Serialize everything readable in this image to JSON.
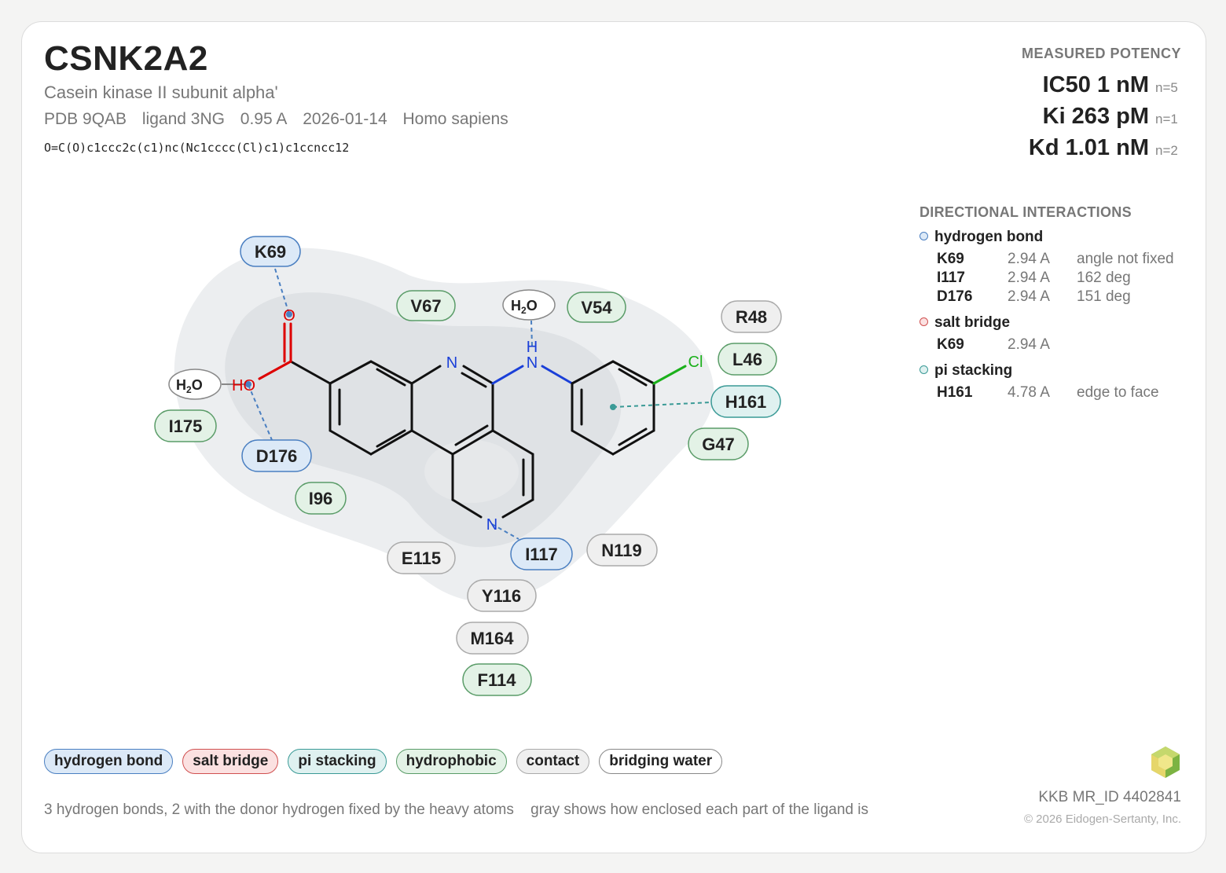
{
  "header": {
    "gene": "CSNK2A2",
    "protein": "Casein kinase II subunit alpha'",
    "pdb": "PDB 9QAB",
    "ligand": "ligand 3NG",
    "resolution": "0.95 A",
    "date": "2026-01-14",
    "organism": "Homo sapiens",
    "smiles": "O=C(O)c1ccc2c(c1)nc(Nc1cccc(Cl)c1)c1ccncc12"
  },
  "potency": {
    "heading": "MEASURED POTENCY",
    "rows": [
      {
        "label": "IC50 1 nM",
        "n": "n=5"
      },
      {
        "label": "Ki 263 pM",
        "n": "n=1"
      },
      {
        "label": "Kd 1.01 nM",
        "n": "n=2"
      }
    ]
  },
  "interactions": {
    "heading": "DIRECTIONAL INTERACTIONS",
    "hbond_title": "hydrogen bond",
    "hbond": [
      {
        "res": "K69",
        "dist": "2.94 A",
        "note": "angle not fixed"
      },
      {
        "res": "I117",
        "dist": "2.94 A",
        "note": "162 deg"
      },
      {
        "res": "D176",
        "dist": "2.94 A",
        "note": "151 deg"
      }
    ],
    "salt_title": "salt bridge",
    "salt": [
      {
        "res": "K69",
        "dist": "2.94 A",
        "note": ""
      }
    ],
    "pi_title": "pi stacking",
    "pi": [
      {
        "res": "H161",
        "dist": "4.78 A",
        "note": "edge to face"
      }
    ]
  },
  "residues": {
    "K69": "K69",
    "V67": "V67",
    "V54": "V54",
    "R48": "R48",
    "L46": "L46",
    "H161": "H161",
    "G47": "G47",
    "I175": "I175",
    "D176": "D176",
    "I96": "I96",
    "E115": "E115",
    "I117": "I117",
    "N119": "N119",
    "Y116": "Y116",
    "M164": "M164",
    "F114": "F114"
  },
  "atoms": {
    "O": "O",
    "HO": "HO",
    "N": "N",
    "H": "H",
    "Cl": "Cl",
    "water": "H",
    "water_sub": "2",
    "water_o": "O"
  },
  "legend": {
    "hbond": "hydrogen bond",
    "salt": "salt bridge",
    "pi": "pi stacking",
    "hydrophobic": "hydrophobic",
    "contact": "contact",
    "water": "bridging water"
  },
  "colors": {
    "hbond_fill": "#dce9f7",
    "hbond_stroke": "#4a7fc1",
    "salt_fill": "#fbe1e1",
    "salt_stroke": "#d05050",
    "pi_fill": "#dff1f0",
    "pi_stroke": "#3a9a96",
    "hydro_fill": "#e3f2e6",
    "hydro_stroke": "#5a9c68",
    "contact_fill": "#efefef",
    "contact_stroke": "#aaaaaa",
    "water_fill": "#ffffff",
    "water_stroke": "#888888"
  },
  "footer": {
    "note1": "3 hydrogen bonds, 2 with the donor hydrogen fixed by the heavy atoms",
    "note2": "gray shows how enclosed each part of the ligand is",
    "mr_id": "KKB MR_ID 4402841",
    "copyright": "© 2026 Eidogen-Sertanty, Inc."
  },
  "logo_icon": "hexagon-cube-logo"
}
